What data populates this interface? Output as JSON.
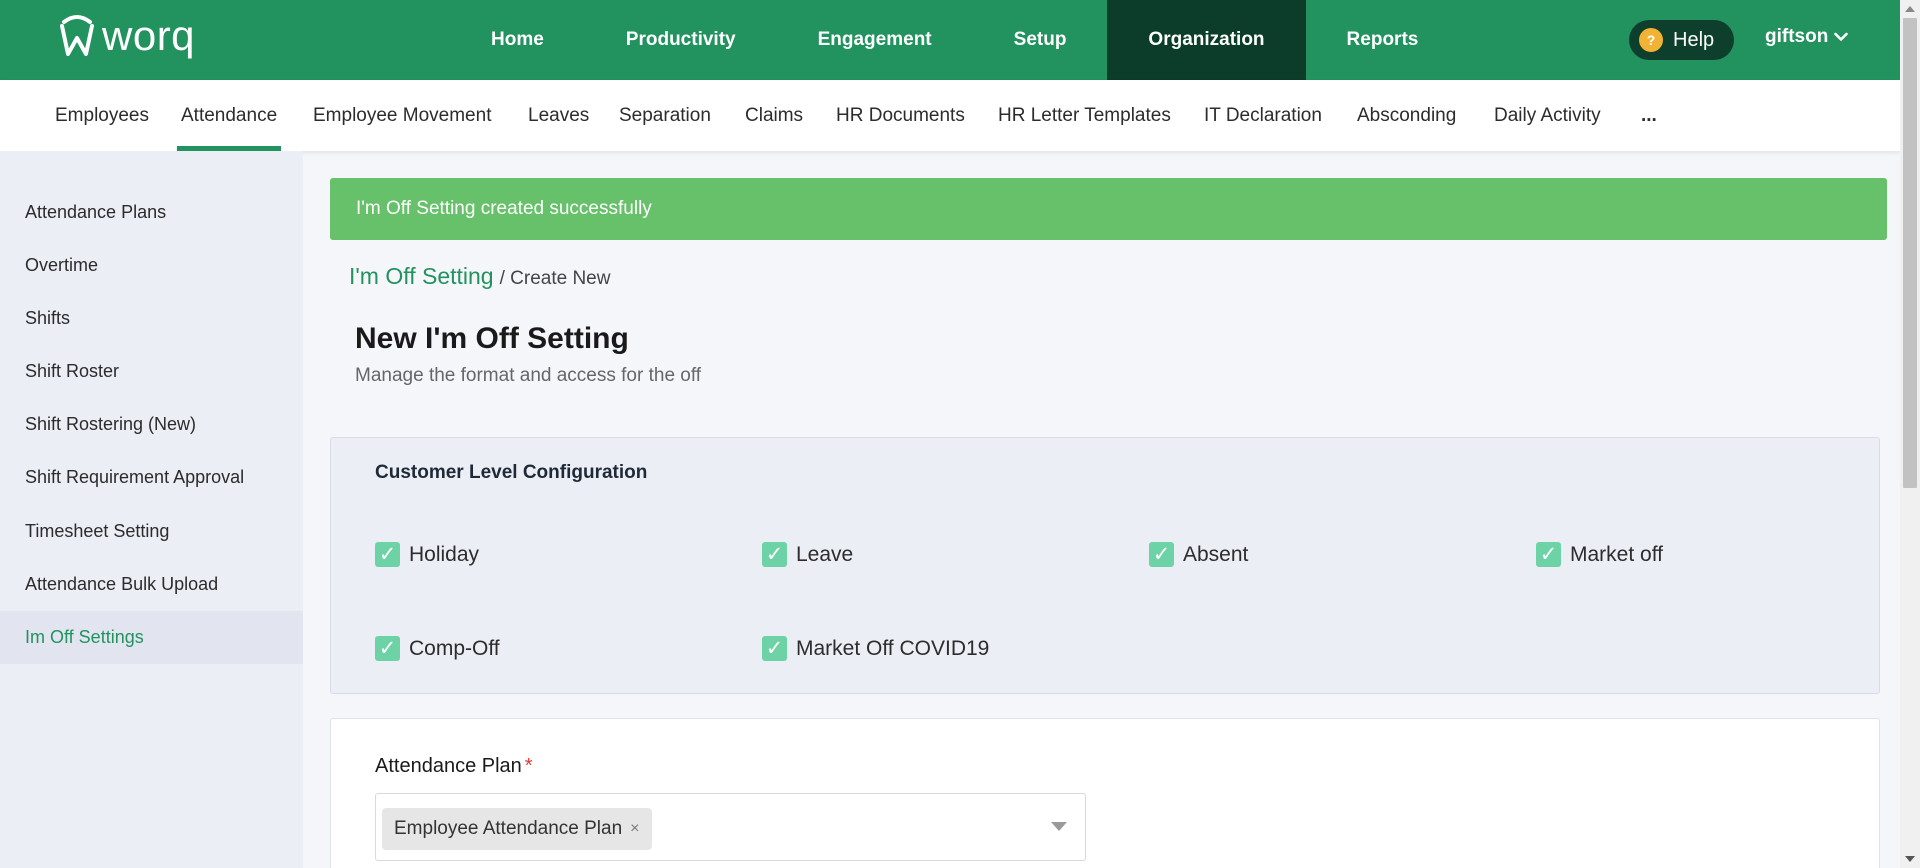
{
  "topbar": {
    "logo_text": "worq",
    "nav": [
      "Home",
      "Productivity",
      "Engagement",
      "Setup",
      "Organization",
      "Reports"
    ],
    "active_nav": "Organization",
    "help_label": "Help",
    "user_name": "giftson",
    "bg_color": "#22925f",
    "active_color": "#0b3d2a"
  },
  "subtabs": {
    "items": [
      "Employees",
      "Attendance",
      "Employee Movement",
      "Leaves",
      "Separation",
      "Claims",
      "HR Documents",
      "HR Letter Templates",
      "IT Declaration",
      "Absconding",
      "Daily Activity",
      "..."
    ],
    "active": "Attendance"
  },
  "sidebar": {
    "items": [
      "Attendance Plans",
      "Overtime",
      "Shifts",
      "Shift Roster",
      "Shift Rostering (New)",
      "Shift Requirement Approval",
      "Timesheet Setting",
      "Attendance Bulk Upload",
      "Im Off Settings"
    ],
    "active": "Im Off Settings"
  },
  "alert": {
    "message": "I'm Off Setting created successfully",
    "color": "#66c16a"
  },
  "breadcrumb": {
    "link": "I'm Off Setting",
    "current": "/ Create New"
  },
  "page": {
    "title": "New I'm Off Setting",
    "subtitle": "Manage the format and access for the off"
  },
  "config": {
    "title": "Customer Level Configuration",
    "options": [
      {
        "label": "Holiday",
        "checked": true
      },
      {
        "label": "Leave",
        "checked": true
      },
      {
        "label": "Absent",
        "checked": true
      },
      {
        "label": "Market off",
        "checked": true
      },
      {
        "label": "Comp-Off",
        "checked": true
      },
      {
        "label": "Market Off COVID19",
        "checked": true
      }
    ]
  },
  "attendance_plan": {
    "label": "Attendance Plan",
    "required_mark": "*",
    "selected": "Employee Attendance Plan",
    "remove_glyph": "×"
  }
}
